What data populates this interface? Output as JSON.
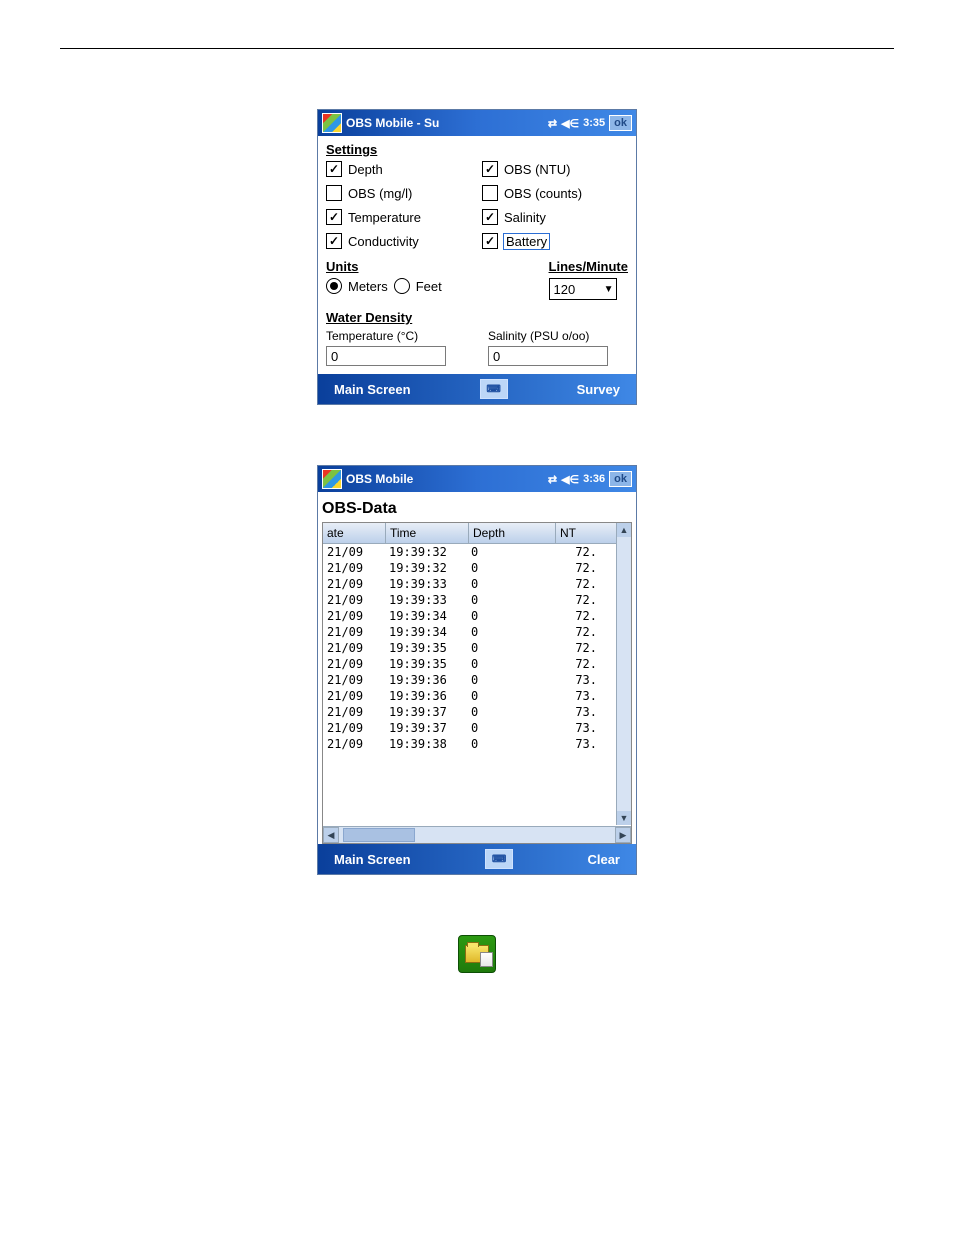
{
  "screen1": {
    "title": "OBS Mobile - Su",
    "clock": "3:35",
    "ok": "ok",
    "section_settings": "Settings",
    "checks": {
      "depth": {
        "label": "Depth",
        "checked": true
      },
      "obs_ntu": {
        "label": "OBS (NTU)",
        "checked": true
      },
      "obs_mgl": {
        "label": "OBS (mg/l)",
        "checked": false
      },
      "obs_counts": {
        "label": "OBS (counts)",
        "checked": false
      },
      "temperature": {
        "label": "Temperature",
        "checked": true
      },
      "salinity": {
        "label": "Salinity",
        "checked": true
      },
      "conductivity": {
        "label": "Conductivity",
        "checked": true
      },
      "battery": {
        "label": "Battery",
        "checked": true
      }
    },
    "section_units": "Units",
    "units_meters": "Meters",
    "units_feet": "Feet",
    "units_selected": "meters",
    "section_lpm": "Lines/Minute",
    "lpm_value": "120",
    "section_density": "Water Density",
    "density_temp_label": "Temperature (°C)",
    "density_temp_value": "0",
    "density_sal_label": "Salinity (PSU o/oo)",
    "density_sal_value": "0",
    "bottom_left": "Main Screen",
    "bottom_right": "Survey"
  },
  "screen2": {
    "title": "OBS Mobile",
    "clock": "3:36",
    "ok": "ok",
    "heading": "OBS-Data",
    "columns": {
      "date": "ate",
      "time": "Time",
      "depth": "Depth",
      "nt": "NT"
    },
    "rows": [
      {
        "date": "21/09",
        "time": "19:39:32",
        "depth": "0",
        "nt": "72."
      },
      {
        "date": "21/09",
        "time": "19:39:32",
        "depth": "0",
        "nt": "72."
      },
      {
        "date": "21/09",
        "time": "19:39:33",
        "depth": "0",
        "nt": "72."
      },
      {
        "date": "21/09",
        "time": "19:39:33",
        "depth": "0",
        "nt": "72."
      },
      {
        "date": "21/09",
        "time": "19:39:34",
        "depth": "0",
        "nt": "72."
      },
      {
        "date": "21/09",
        "time": "19:39:34",
        "depth": "0",
        "nt": "72."
      },
      {
        "date": "21/09",
        "time": "19:39:35",
        "depth": "0",
        "nt": "72."
      },
      {
        "date": "21/09",
        "time": "19:39:35",
        "depth": "0",
        "nt": "72."
      },
      {
        "date": "21/09",
        "time": "19:39:36",
        "depth": "0",
        "nt": "73."
      },
      {
        "date": "21/09",
        "time": "19:39:36",
        "depth": "0",
        "nt": "73."
      },
      {
        "date": "21/09",
        "time": "19:39:37",
        "depth": "0",
        "nt": "73."
      },
      {
        "date": "21/09",
        "time": "19:39:37",
        "depth": "0",
        "nt": "73."
      },
      {
        "date": "21/09",
        "time": "19:39:38",
        "depth": "0",
        "nt": "73."
      }
    ],
    "bottom_left": "Main Screen",
    "bottom_right": "Clear"
  }
}
